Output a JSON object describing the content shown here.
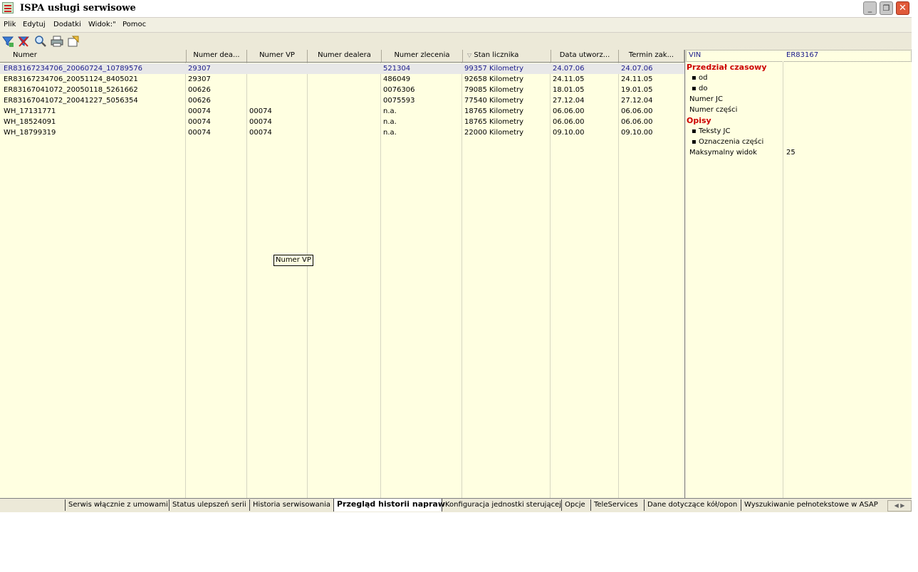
{
  "window": {
    "title": "ISPA usługi serwisowe"
  },
  "menu": [
    "Plik",
    "Edytuj",
    "Dodatki",
    "Widok:\"",
    "Pomoc"
  ],
  "toolbar": {
    "icons": [
      "filter-icon",
      "clear-filter-icon",
      "search-icon",
      "print-icon",
      "export-icon"
    ]
  },
  "table": {
    "sort_indicator": "▽",
    "columns": [
      "Numer",
      "Numer dea...",
      "Numer VP",
      "Numer dealera",
      "Numer zlecenia",
      "Stan licznika",
      "Data utworz...",
      "Termin zak..."
    ],
    "rows": [
      [
        "ER83167234706_20060724_10789576",
        "29307",
        "",
        "",
        "521304",
        "99357 Kilometry",
        "24.07.06",
        "24.07.06"
      ],
      [
        "ER83167234706_20051124_8405021",
        "29307",
        "",
        "",
        "486049",
        "92658 Kilometry",
        "24.11.05",
        "24.11.05"
      ],
      [
        "ER83167041072_20050118_5261662",
        "00626",
        "",
        "",
        "0076306",
        "79085 Kilometry",
        "18.01.05",
        "19.01.05"
      ],
      [
        "ER83167041072_20041227_5056354",
        "00626",
        "",
        "",
        "0075593",
        "77540 Kilometry",
        "27.12.04",
        "27.12.04"
      ],
      [
        "WH_17131771",
        "00074",
        "00074",
        "",
        "n.a.",
        "18765 Kilometry",
        "06.06.00",
        "06.06.00"
      ],
      [
        "WH_18524091",
        "00074",
        "00074",
        "",
        "n.a.",
        "18765 Kilometry",
        "06.06.00",
        "06.06.00"
      ],
      [
        "WH_18799319",
        "00074",
        "00074",
        "",
        "n.a.",
        "22000 Kilometry",
        "09.10.00",
        "09.10.00"
      ]
    ],
    "selected_row": 0,
    "tooltip": "Numer VP"
  },
  "panel": {
    "header_label": "VIN",
    "header_value": "ER83167",
    "section_time": "Przedział czasowy",
    "od": "od",
    "do": "do",
    "numer_jc": "Numer JC",
    "numer_czesci": "Numer części",
    "section_opisy": "Opisy",
    "teksty_jc": "Teksty JC",
    "oznaczenia_czesci": "Oznaczenia części",
    "maks_widok_label": "Maksymalny widok",
    "maks_widok_value": "25"
  },
  "tabs": [
    "Serwis włącznie z umowami",
    "Status ulepszeń serii",
    "Historia serwisowania",
    "Przegląd historii napraw",
    "Konfiguracja jednostki sterującej",
    "Opcje",
    "TeleServices",
    "Dane dotyczące kół/opon",
    "Wyszukiwanie pełnotekstowe w ASAP"
  ],
  "active_tab": 3,
  "colors": {
    "grid_bg": "#ffffe1",
    "section_red": "#cc0000",
    "selected_text": "#1a1a8a"
  }
}
